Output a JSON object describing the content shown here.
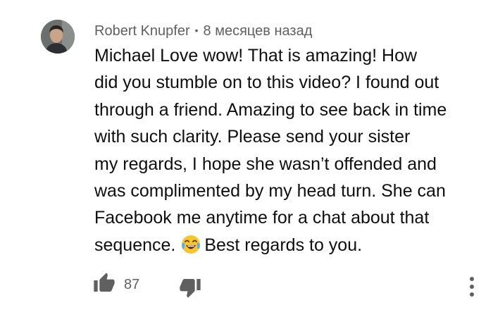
{
  "comment": {
    "author": "Robert Knupfer",
    "separator": "•",
    "timestamp": "8 месяцев назад",
    "text_lines": [
      "Michael Love wow! That is amazing! How",
      "did you stumble on to this video? I found out",
      "through a friend. Amazing to see back in time",
      "with such clarity. Please send your sister",
      "my regards, I hope she wasn’t offended and",
      "was complimented by my head turn. She can",
      "Facebook me anytime for a chat about that",
      "sequence.",
      "Best regards to you."
    ],
    "emoji": "laughing-crying-emoji",
    "like_count": "87"
  },
  "icons": {
    "like": "thumbs-up-icon",
    "dislike": "thumbs-down-icon",
    "more": "more-vert-icon"
  }
}
